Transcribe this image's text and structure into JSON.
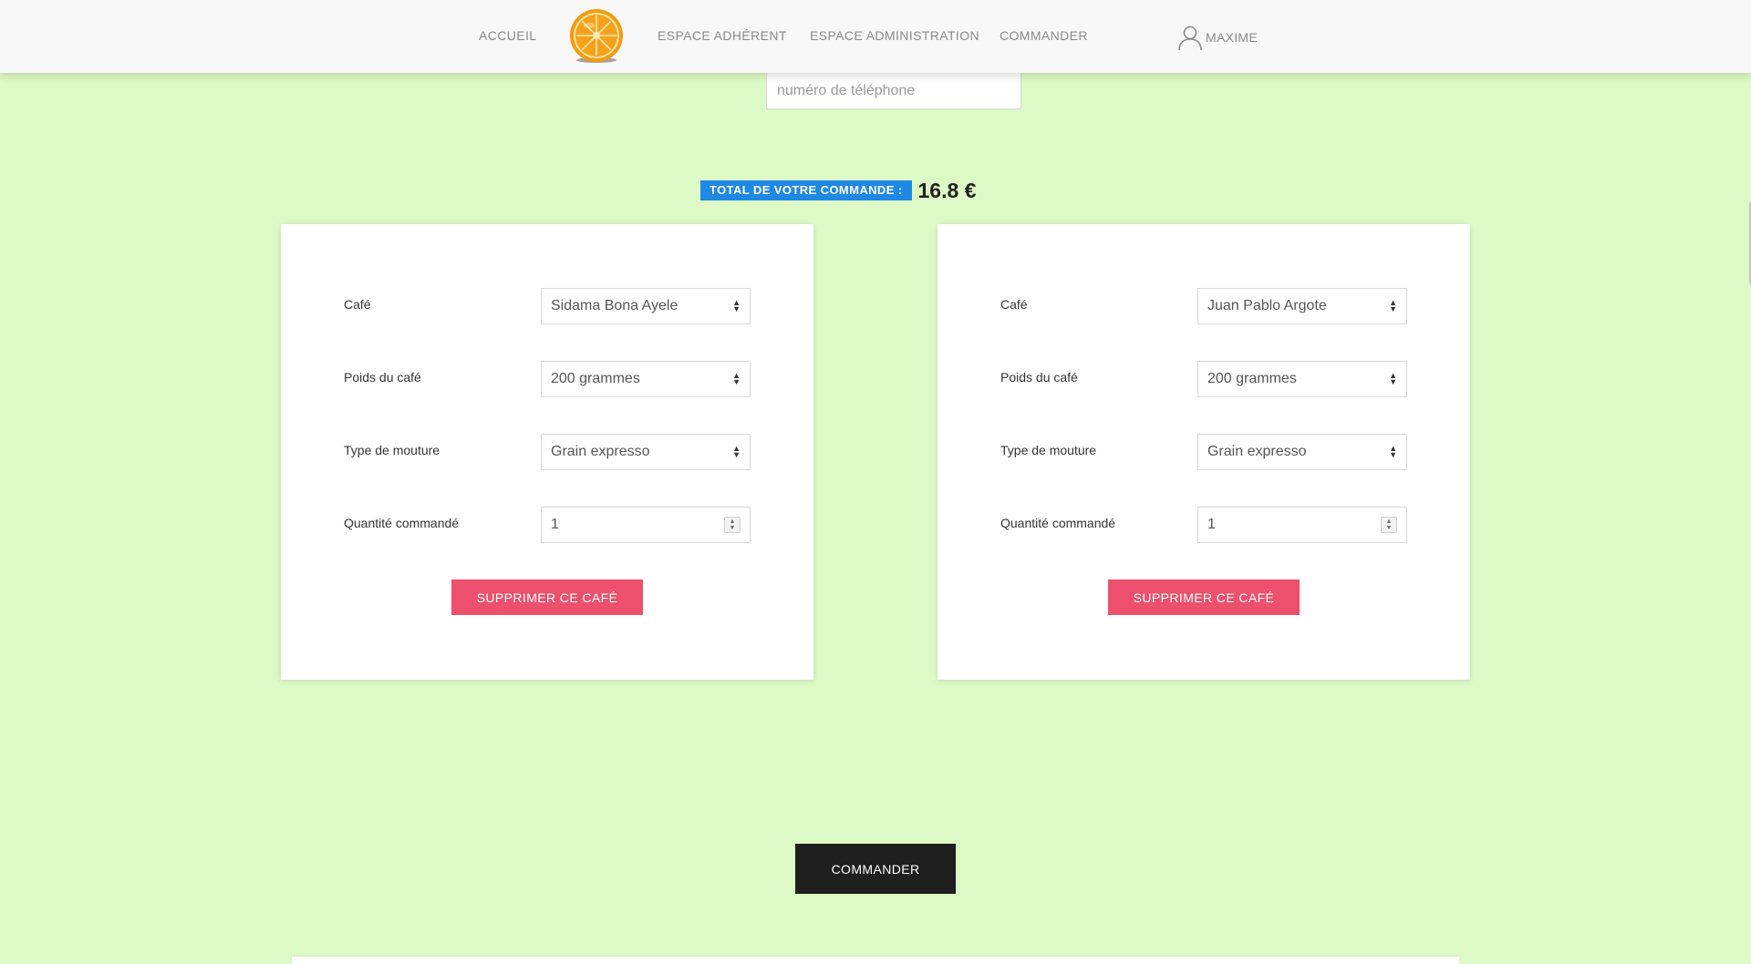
{
  "nav": {
    "items": [
      {
        "label": "ACCUEIL"
      },
      {
        "label": "ESPACE ADHÉRENT"
      },
      {
        "label": "ESPACE ADMINISTRATION"
      },
      {
        "label": "COMMANDER"
      }
    ],
    "user": {
      "label": "MAXIME",
      "icon": "user-icon"
    },
    "logo": {
      "icon": "orange-slice-logo"
    }
  },
  "form": {
    "phone": {
      "placeholder": "numéro de téléphone",
      "value": ""
    }
  },
  "total": {
    "label": "TOTAL DE VOTRE COMMANDE :",
    "amount": "16.8 €"
  },
  "cards": [
    {
      "fields": {
        "coffee": {
          "label": "Café",
          "value": "Sidama Bona Ayele"
        },
        "weight": {
          "label": "Poids du café",
          "value": "200 grammes"
        },
        "grind": {
          "label": "Type de mouture",
          "value": "Grain expresso"
        },
        "quantity": {
          "label": "Quantité commandé",
          "value": "1"
        }
      },
      "delete_label": "SUPPRIMER CE CAFÉ"
    },
    {
      "fields": {
        "coffee": {
          "label": "Café",
          "value": "Juan Pablo Argote"
        },
        "weight": {
          "label": "Poids du café",
          "value": "200 grammes"
        },
        "grind": {
          "label": "Type de mouture",
          "value": "Grain expresso"
        },
        "quantity": {
          "label": "Quantité commandé",
          "value": "1"
        }
      },
      "delete_label": "SUPPRIMER CE CAFÉ"
    }
  ],
  "submit": {
    "label": "COMMANDER"
  },
  "colors": {
    "background": "#ddf9c5",
    "navbar": "#f8f8f8",
    "total_badge": "#1e88e5",
    "delete_button": "#ec506c",
    "submit_button": "#1f1f1f"
  }
}
